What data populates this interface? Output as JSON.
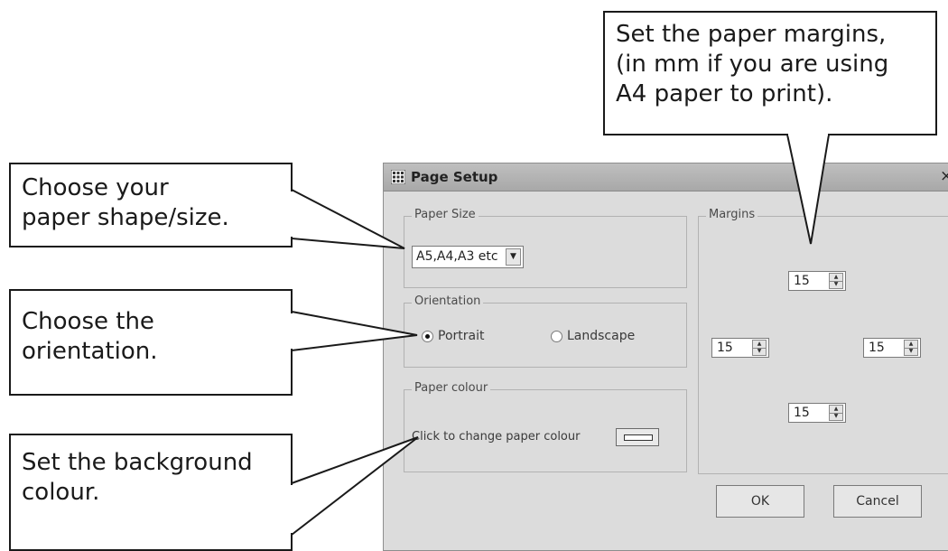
{
  "callouts": {
    "margins": [
      "Set the paper margins,",
      "(in mm if you are using",
      "A4 paper to print)."
    ],
    "paper_size": [
      "Choose your",
      "paper shape/size."
    ],
    "orientation": [
      "Choose the",
      "orientation."
    ],
    "background": [
      "Set the background",
      "colour."
    ]
  },
  "dialog": {
    "title": "Page Setup",
    "close_glyph": "×",
    "paper_size": {
      "group_label": "Paper Size",
      "selected_value": "A5,A4,A3 etc"
    },
    "orientation": {
      "group_label": "Orientation",
      "portrait_label": "Portrait",
      "landscape_label": "Landscape",
      "selected": "Portrait"
    },
    "paper_colour": {
      "group_label": "Paper colour",
      "text": "Click to change paper colour"
    },
    "margins": {
      "group_label": "Margins",
      "top": "15",
      "left": "15",
      "right": "15",
      "bottom": "15"
    },
    "ok_label": "OK",
    "cancel_label": "Cancel"
  },
  "icons": {
    "app": "grid-icon",
    "dropdown": "chevron-down-icon",
    "spin_up": "spin-up-icon",
    "spin_down": "spin-down-icon"
  },
  "colors": {
    "dialog_bg": "#dcdcdc",
    "titlebar": "#b4b4b4",
    "callout_border": "#1a1a1a"
  }
}
